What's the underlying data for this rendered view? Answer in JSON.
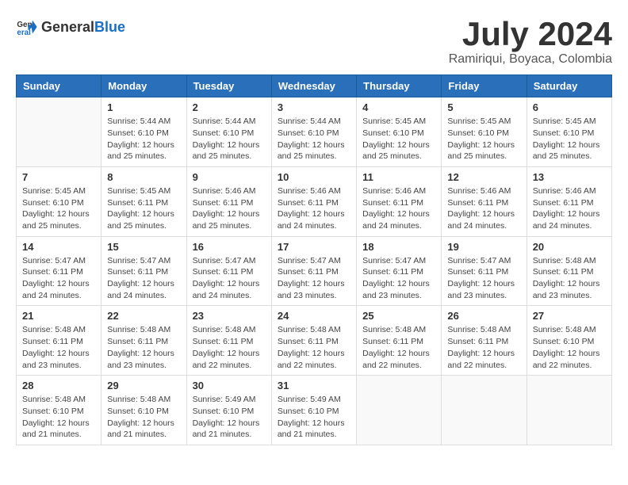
{
  "logo": {
    "general": "General",
    "blue": "Blue"
  },
  "title": "July 2024",
  "subtitle": "Ramiriqui, Boyaca, Colombia",
  "weekdays": [
    "Sunday",
    "Monday",
    "Tuesday",
    "Wednesday",
    "Thursday",
    "Friday",
    "Saturday"
  ],
  "weeks": [
    [
      {
        "day": "",
        "sunrise": "",
        "sunset": "",
        "daylight": ""
      },
      {
        "day": "1",
        "sunrise": "Sunrise: 5:44 AM",
        "sunset": "Sunset: 6:10 PM",
        "daylight": "Daylight: 12 hours and 25 minutes."
      },
      {
        "day": "2",
        "sunrise": "Sunrise: 5:44 AM",
        "sunset": "Sunset: 6:10 PM",
        "daylight": "Daylight: 12 hours and 25 minutes."
      },
      {
        "day": "3",
        "sunrise": "Sunrise: 5:44 AM",
        "sunset": "Sunset: 6:10 PM",
        "daylight": "Daylight: 12 hours and 25 minutes."
      },
      {
        "day": "4",
        "sunrise": "Sunrise: 5:45 AM",
        "sunset": "Sunset: 6:10 PM",
        "daylight": "Daylight: 12 hours and 25 minutes."
      },
      {
        "day": "5",
        "sunrise": "Sunrise: 5:45 AM",
        "sunset": "Sunset: 6:10 PM",
        "daylight": "Daylight: 12 hours and 25 minutes."
      },
      {
        "day": "6",
        "sunrise": "Sunrise: 5:45 AM",
        "sunset": "Sunset: 6:10 PM",
        "daylight": "Daylight: 12 hours and 25 minutes."
      }
    ],
    [
      {
        "day": "7",
        "sunrise": "Sunrise: 5:45 AM",
        "sunset": "Sunset: 6:10 PM",
        "daylight": "Daylight: 12 hours and 25 minutes."
      },
      {
        "day": "8",
        "sunrise": "Sunrise: 5:45 AM",
        "sunset": "Sunset: 6:11 PM",
        "daylight": "Daylight: 12 hours and 25 minutes."
      },
      {
        "day": "9",
        "sunrise": "Sunrise: 5:46 AM",
        "sunset": "Sunset: 6:11 PM",
        "daylight": "Daylight: 12 hours and 25 minutes."
      },
      {
        "day": "10",
        "sunrise": "Sunrise: 5:46 AM",
        "sunset": "Sunset: 6:11 PM",
        "daylight": "Daylight: 12 hours and 24 minutes."
      },
      {
        "day": "11",
        "sunrise": "Sunrise: 5:46 AM",
        "sunset": "Sunset: 6:11 PM",
        "daylight": "Daylight: 12 hours and 24 minutes."
      },
      {
        "day": "12",
        "sunrise": "Sunrise: 5:46 AM",
        "sunset": "Sunset: 6:11 PM",
        "daylight": "Daylight: 12 hours and 24 minutes."
      },
      {
        "day": "13",
        "sunrise": "Sunrise: 5:46 AM",
        "sunset": "Sunset: 6:11 PM",
        "daylight": "Daylight: 12 hours and 24 minutes."
      }
    ],
    [
      {
        "day": "14",
        "sunrise": "Sunrise: 5:47 AM",
        "sunset": "Sunset: 6:11 PM",
        "daylight": "Daylight: 12 hours and 24 minutes."
      },
      {
        "day": "15",
        "sunrise": "Sunrise: 5:47 AM",
        "sunset": "Sunset: 6:11 PM",
        "daylight": "Daylight: 12 hours and 24 minutes."
      },
      {
        "day": "16",
        "sunrise": "Sunrise: 5:47 AM",
        "sunset": "Sunset: 6:11 PM",
        "daylight": "Daylight: 12 hours and 24 minutes."
      },
      {
        "day": "17",
        "sunrise": "Sunrise: 5:47 AM",
        "sunset": "Sunset: 6:11 PM",
        "daylight": "Daylight: 12 hours and 23 minutes."
      },
      {
        "day": "18",
        "sunrise": "Sunrise: 5:47 AM",
        "sunset": "Sunset: 6:11 PM",
        "daylight": "Daylight: 12 hours and 23 minutes."
      },
      {
        "day": "19",
        "sunrise": "Sunrise: 5:47 AM",
        "sunset": "Sunset: 6:11 PM",
        "daylight": "Daylight: 12 hours and 23 minutes."
      },
      {
        "day": "20",
        "sunrise": "Sunrise: 5:48 AM",
        "sunset": "Sunset: 6:11 PM",
        "daylight": "Daylight: 12 hours and 23 minutes."
      }
    ],
    [
      {
        "day": "21",
        "sunrise": "Sunrise: 5:48 AM",
        "sunset": "Sunset: 6:11 PM",
        "daylight": "Daylight: 12 hours and 23 minutes."
      },
      {
        "day": "22",
        "sunrise": "Sunrise: 5:48 AM",
        "sunset": "Sunset: 6:11 PM",
        "daylight": "Daylight: 12 hours and 23 minutes."
      },
      {
        "day": "23",
        "sunrise": "Sunrise: 5:48 AM",
        "sunset": "Sunset: 6:11 PM",
        "daylight": "Daylight: 12 hours and 22 minutes."
      },
      {
        "day": "24",
        "sunrise": "Sunrise: 5:48 AM",
        "sunset": "Sunset: 6:11 PM",
        "daylight": "Daylight: 12 hours and 22 minutes."
      },
      {
        "day": "25",
        "sunrise": "Sunrise: 5:48 AM",
        "sunset": "Sunset: 6:11 PM",
        "daylight": "Daylight: 12 hours and 22 minutes."
      },
      {
        "day": "26",
        "sunrise": "Sunrise: 5:48 AM",
        "sunset": "Sunset: 6:11 PM",
        "daylight": "Daylight: 12 hours and 22 minutes."
      },
      {
        "day": "27",
        "sunrise": "Sunrise: 5:48 AM",
        "sunset": "Sunset: 6:10 PM",
        "daylight": "Daylight: 12 hours and 22 minutes."
      }
    ],
    [
      {
        "day": "28",
        "sunrise": "Sunrise: 5:48 AM",
        "sunset": "Sunset: 6:10 PM",
        "daylight": "Daylight: 12 hours and 21 minutes."
      },
      {
        "day": "29",
        "sunrise": "Sunrise: 5:48 AM",
        "sunset": "Sunset: 6:10 PM",
        "daylight": "Daylight: 12 hours and 21 minutes."
      },
      {
        "day": "30",
        "sunrise": "Sunrise: 5:49 AM",
        "sunset": "Sunset: 6:10 PM",
        "daylight": "Daylight: 12 hours and 21 minutes."
      },
      {
        "day": "31",
        "sunrise": "Sunrise: 5:49 AM",
        "sunset": "Sunset: 6:10 PM",
        "daylight": "Daylight: 12 hours and 21 minutes."
      },
      {
        "day": "",
        "sunrise": "",
        "sunset": "",
        "daylight": ""
      },
      {
        "day": "",
        "sunrise": "",
        "sunset": "",
        "daylight": ""
      },
      {
        "day": "",
        "sunrise": "",
        "sunset": "",
        "daylight": ""
      }
    ]
  ]
}
